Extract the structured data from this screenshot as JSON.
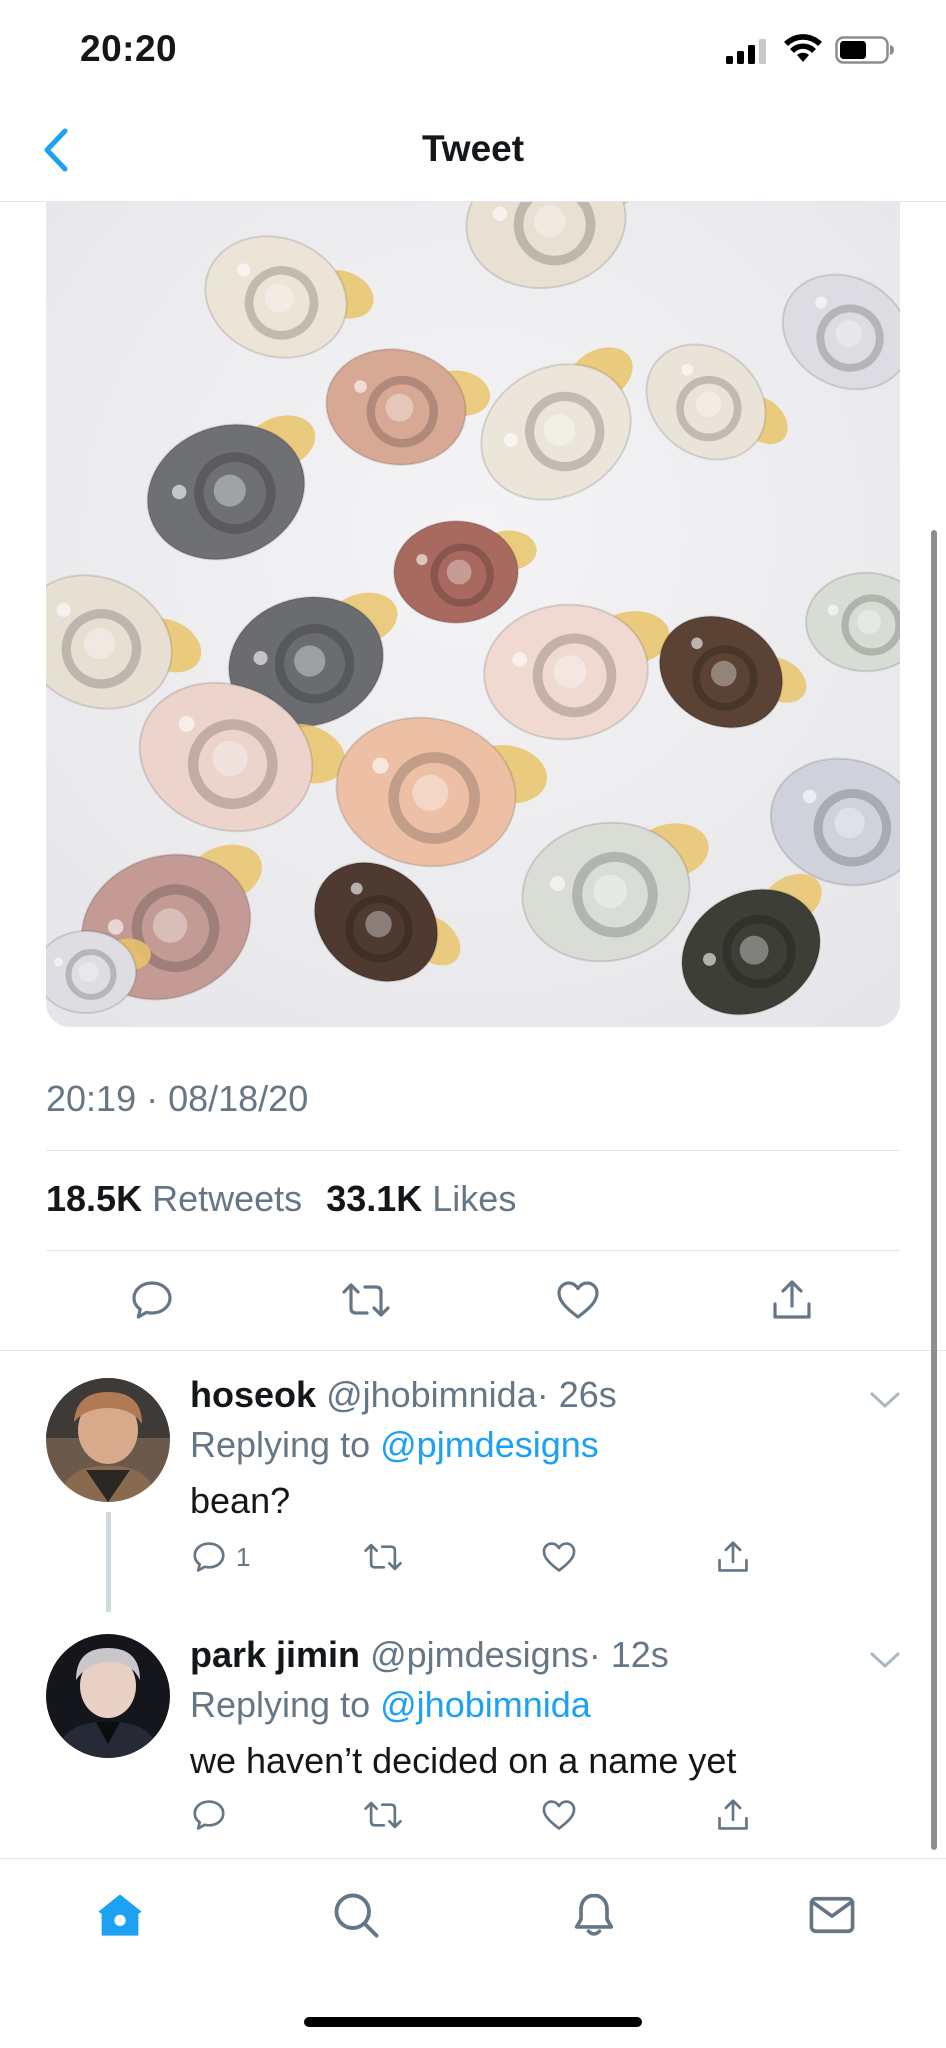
{
  "status_bar": {
    "time": "20:20"
  },
  "nav": {
    "title": "Tweet"
  },
  "tweet": {
    "timestamp": "20:19 · 08/18/20",
    "retweets_count": "18.5K",
    "retweets_label": "Retweets",
    "likes_count": "33.1K",
    "likes_label": "Likes"
  },
  "replies": [
    {
      "name": "hoseok",
      "handle": "@jhobimnida",
      "time": "· 26s",
      "replying_label": "Replying to",
      "replying_to": "@pjmdesigns",
      "text": "bean?",
      "reply_count": "1"
    },
    {
      "name": "park jimin",
      "handle": "@pjmdesigns",
      "time": "· 12s",
      "replying_label": "Replying to",
      "replying_to": "@jhobimnida",
      "text": "we haven’t decided on a name yet",
      "reply_count": ""
    }
  ],
  "colors": {
    "accent": "#1da1f2",
    "secondary_text": "#657786",
    "divider": "#e1e8ed"
  },
  "icons": [
    "back-chevron-icon",
    "reply-icon",
    "retweet-icon",
    "like-icon",
    "share-icon",
    "home-icon",
    "search-icon",
    "notifications-icon",
    "messages-icon"
  ]
}
